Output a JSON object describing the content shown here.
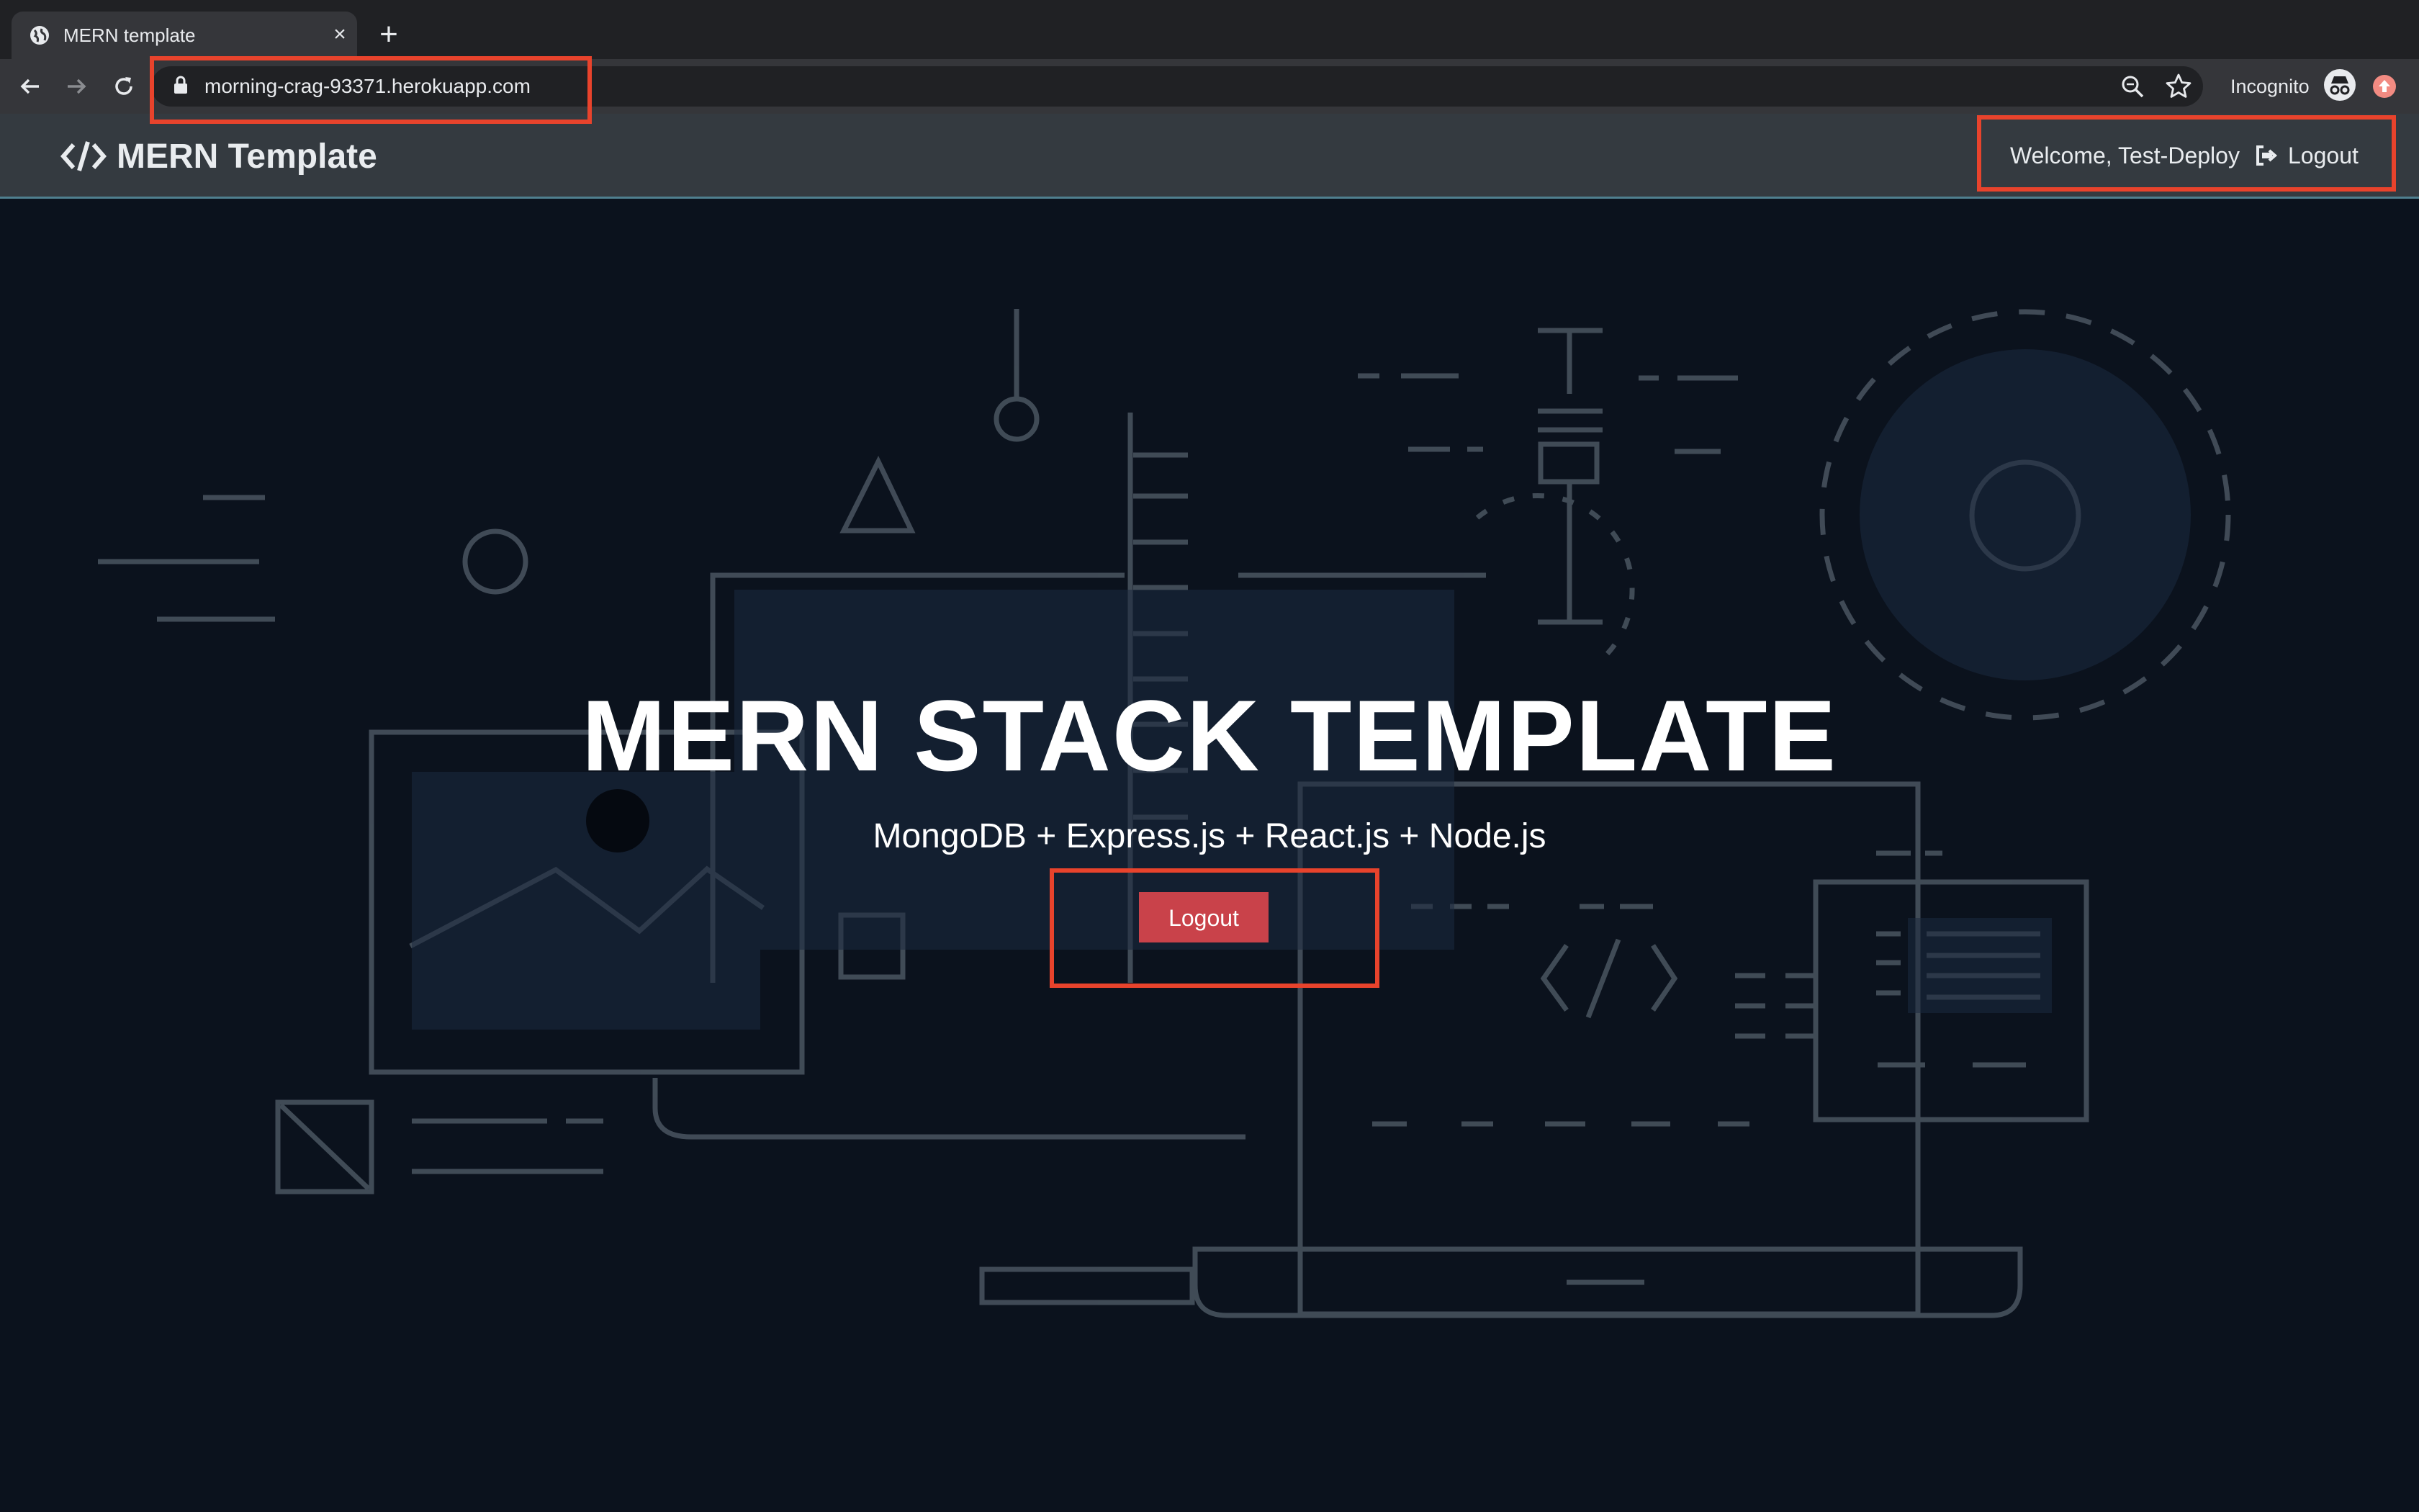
{
  "browser": {
    "tab": {
      "title": "MERN template",
      "close_icon": "close-icon"
    },
    "new_tab_icon": "plus-icon",
    "url": "morning-crag-93371.herokuapp.com",
    "incognito_label": "Incognito"
  },
  "navbar": {
    "brand": "MERN Template",
    "brand_icon": "code-icon",
    "welcome": "Welcome, Test-Deploy",
    "logout_label": "Logout",
    "logout_icon": "sign-out-icon"
  },
  "hero": {
    "title": "MERN STACK TEMPLATE",
    "subtitle": "MongoDB + Express.js + React.js + Node.js",
    "logout_button": "Logout"
  },
  "colors": {
    "navbar_bg": "#343a40",
    "hero_bg": "#0b121d",
    "button_red": "#c9424a",
    "annotation_red": "#e8432c"
  }
}
